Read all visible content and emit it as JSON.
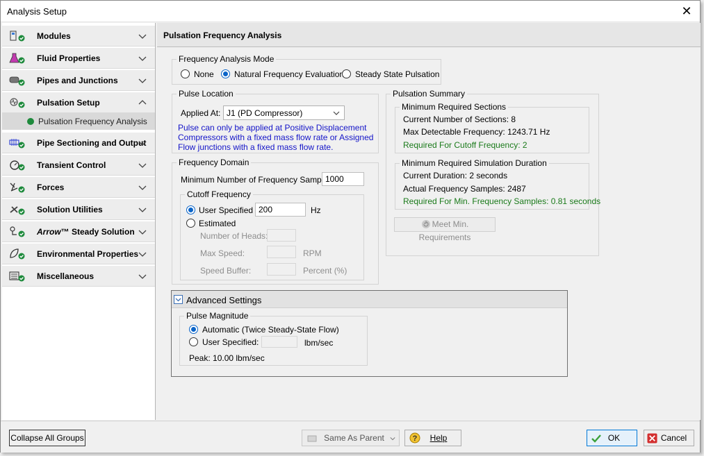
{
  "window": {
    "title": "Analysis Setup",
    "close_glyph": "✕"
  },
  "sidebar": {
    "groups": [
      {
        "label": "Modules",
        "icon": "modules-icon"
      },
      {
        "label": "Fluid Properties",
        "icon": "flask-icon"
      },
      {
        "label": "Pipes and Junctions",
        "icon": "pipe-icon"
      },
      {
        "label": "Pulsation Setup",
        "icon": "pulsation-icon",
        "expanded": true
      },
      {
        "label": "Pipe Sectioning and Output",
        "icon": "sectioning-icon"
      },
      {
        "label": "Transient Control",
        "icon": "stopwatch-icon"
      },
      {
        "label": "Forces",
        "icon": "forces-icon"
      },
      {
        "label": "Solution Utilities",
        "icon": "tools-icon"
      },
      {
        "label": "™ Steady Solution",
        "brand": "Arrow",
        "icon": "steady-solution-icon"
      },
      {
        "label": "Environmental Properties",
        "icon": "leaf-icon"
      },
      {
        "label": "Miscellaneous",
        "icon": "misc-icon"
      }
    ],
    "subitems": [
      {
        "label": "Pulsation Frequency Analysis"
      }
    ]
  },
  "panel": {
    "title": "Pulsation Frequency Analysis",
    "mode": {
      "legend": "Frequency Analysis Mode",
      "options": [
        "None",
        "Natural Frequency Evaluation",
        "Steady State Pulsation"
      ],
      "selected": "Natural Frequency Evaluation"
    },
    "pulse_location": {
      "legend": "Pulse Location",
      "applied_at_label": "Applied At:",
      "applied_at_value": "J1 (PD Compressor)",
      "note_line1": "Pulse can only be applied at Positive Displacement",
      "note_line2": "Compressors with a fixed mass flow rate or Assigned",
      "note_line3": "Flow junctions with a fixed mass flow rate."
    },
    "frequency_domain": {
      "legend": "Frequency Domain",
      "min_samples_label": "Minimum Number of Frequency Samples:",
      "min_samples_value": "1000",
      "cutoff": {
        "legend": "Cutoff Frequency",
        "user_specified_label": "User Specified",
        "user_specified_value": "200",
        "unit": "Hz",
        "estimated_label": "Estimated",
        "heads_label": "Number of Heads:",
        "max_speed_label": "Max Speed:",
        "max_speed_unit": "RPM",
        "speed_buffer_label": "Speed Buffer:",
        "speed_buffer_unit": "Percent (%)"
      }
    },
    "summary": {
      "legend": "Pulsation Summary",
      "sections": {
        "legend": "Minimum Required Sections",
        "current": "Current Number of Sections: 8",
        "max_freq": "Max Detectable Frequency: 1243.71 Hz",
        "required": "Required For Cutoff Frequency: 2"
      },
      "duration": {
        "legend": "Minimum Required Simulation Duration",
        "current": "Current Duration: 2 seconds",
        "actual": "Actual Frequency Samples: 2487",
        "required": "Required For Min. Frequency Samples: 0.81 seconds"
      },
      "meet_button": "Meet Min. Requirements"
    },
    "advanced": {
      "title": "Advanced Settings",
      "magnitude": {
        "legend": "Pulse Magnitude",
        "automatic_label": "Automatic (Twice Steady-State Flow)",
        "user_label": "User Specified:",
        "unit": "lbm/sec",
        "peak": "Peak: 10.00 lbm/sec"
      }
    }
  },
  "footer": {
    "collapse_button": "Collapse All Groups",
    "same_as_parent": "Same As Parent",
    "help": "Help",
    "ok": "OK",
    "cancel": "Cancel"
  },
  "colors": {
    "accent": "#0a64c8",
    "green_status": "#1e8a3c",
    "note_blue": "#1414c8"
  }
}
